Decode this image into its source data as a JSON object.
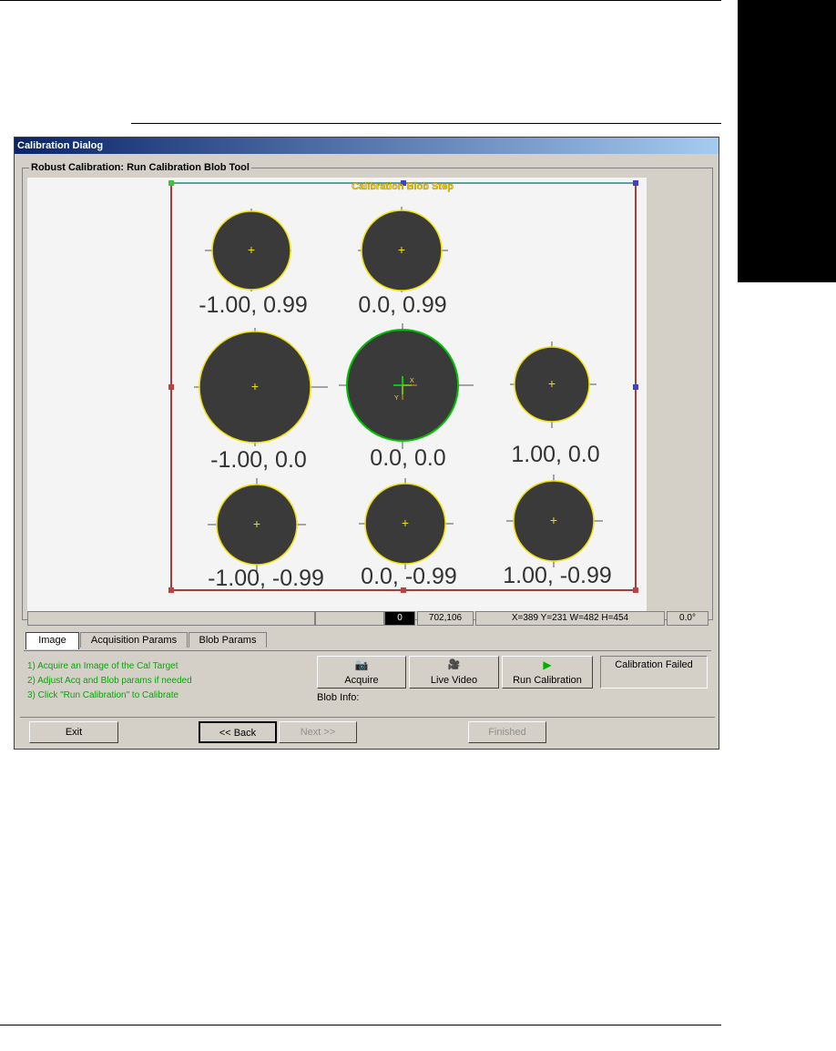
{
  "window": {
    "title": "Calibration Dialog"
  },
  "group": {
    "title": "Robust Calibration: Run Calibration Blob Tool"
  },
  "image": {
    "step_label": "Calibration Blob Step",
    "blobs": [
      {
        "label": "-1.00, 0.99"
      },
      {
        "label": "0.0, 0.99"
      },
      {
        "label": "-1.00, 0.0"
      },
      {
        "label": "0.0, 0.0"
      },
      {
        "label": "1.00, 0.0"
      },
      {
        "label": "-1.00, -0.99"
      },
      {
        "label": "0.0, -0.99"
      },
      {
        "label": "1.00, -0.99"
      }
    ],
    "axis_x": "X",
    "axis_y": "Y",
    "colors": {
      "roi": "#8b0000",
      "blob_outline": "#f0e000",
      "selected_outline": "#00c000",
      "blob_fill": "#3a3a3a"
    }
  },
  "status": {
    "cell1": "",
    "cell2": "",
    "value": "0",
    "cursor": "702,106",
    "roi": "X=389 Y=231 W=482 H=454",
    "angle": "0.0°"
  },
  "tabs": [
    "Image",
    "Acquisition Params",
    "Blob Params"
  ],
  "instructions": [
    "1) Acquire an Image of the Cal Target",
    "2) Adjust Acq and Blob params if needed",
    "3) Click \"Run Calibration\" to Calibrate"
  ],
  "actions": {
    "acquire": "Acquire",
    "live_video": "Live Video",
    "run_calibration": "Run Calibration"
  },
  "result_status": "Calibration Failed",
  "blob_info_label": "Blob Info:",
  "nav": {
    "exit": "Exit",
    "back": "<< Back",
    "next": "Next >>",
    "finished": "Finished"
  }
}
